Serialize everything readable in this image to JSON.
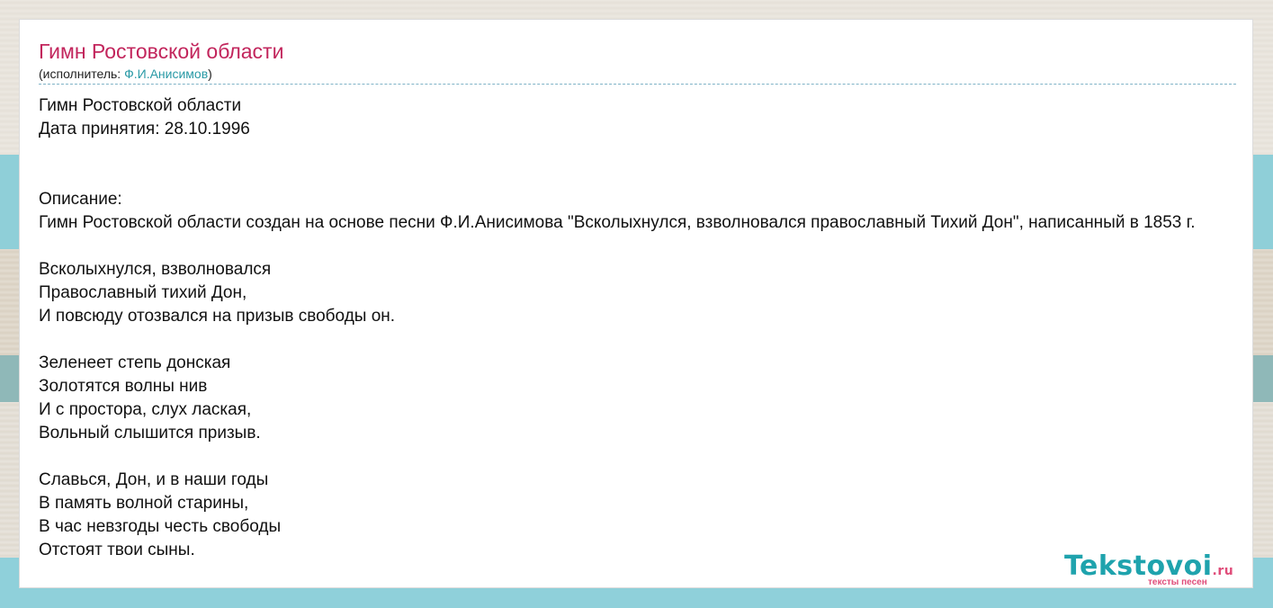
{
  "page": {
    "title": "Гимн Ростовской области",
    "performer_prefix": "(исполнитель: ",
    "performer_name": "Ф.И.Анисимов",
    "performer_suffix": ")"
  },
  "lyrics": [
    "Гимн Ростовской области",
    "Дата принятия: 28.10.1996",
    "",
    "",
    "Описание:",
    "Гимн Ростовской области создан на основе песни Ф.И.Анисимова \"Всколыхнулся, взволновался православный Тихий Дон\", написанный в 1853 г.",
    "",
    "Всколыхнулся, взволновался",
    "Православный тихий Дон,",
    "И повсюду отозвался на призыв свободы он.",
    "",
    "Зеленеет степь донская",
    "Золотятся волны нив",
    "И с простора, слух лаская,",
    "Вольный слышится призыв.",
    "",
    "Славься, Дон, и в наши годы",
    "В память волной старины,",
    "В час невзгоды честь свободы",
    "Отстоят твои сыны."
  ],
  "logo": {
    "main": "Tekstovoi",
    "domain": ".ru",
    "tagline": "тексты песен"
  },
  "colors": {
    "title": "#c2255c",
    "link": "#2a9aa6",
    "logo_main": "#1fa3ad",
    "logo_accent": "#e04d7a"
  }
}
